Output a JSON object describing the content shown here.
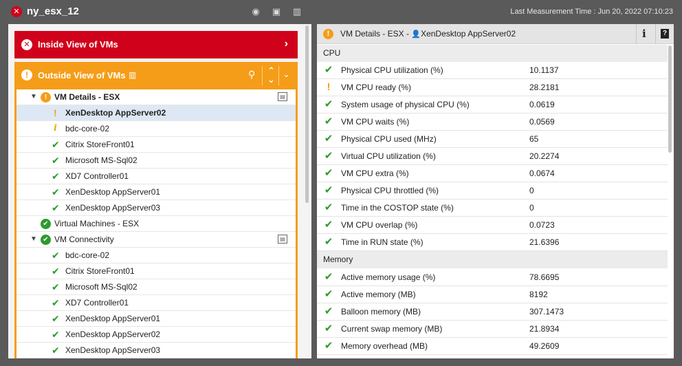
{
  "titlebar": {
    "title": "ny_esx_12",
    "status_icon": "error-x-icon",
    "measurement": "Last Measurement Time : Jun 20, 2022 07:10:23",
    "icons": [
      "alarm-icon",
      "monitor-icon",
      "bar-chart-icon"
    ]
  },
  "inside": {
    "label": "Inside View of VMs"
  },
  "outside": {
    "label": "Outside View of VMs"
  },
  "tree": {
    "vm_details": {
      "label": "VM Details - ESX"
    },
    "details_items": [
      {
        "label": "XenDesktop AppServer02",
        "status": "warning"
      },
      {
        "label": "bdc-core-02",
        "status": "info"
      },
      {
        "label": "Citrix StoreFront01",
        "status": "ok"
      },
      {
        "label": "Microsoft MS-Sql02",
        "status": "ok"
      },
      {
        "label": "XD7 Controller01",
        "status": "ok"
      },
      {
        "label": "XenDesktop AppServer01",
        "status": "ok"
      },
      {
        "label": "XenDesktop AppServer03",
        "status": "ok"
      }
    ],
    "virtual_machines": {
      "label": "Virtual Machines - ESX"
    },
    "vm_connectivity": {
      "label": "VM Connectivity"
    },
    "connectivity_items": [
      {
        "label": "bdc-core-02"
      },
      {
        "label": "Citrix StoreFront01"
      },
      {
        "label": "Microsoft MS-Sql02"
      },
      {
        "label": "XD7 Controller01"
      },
      {
        "label": "XenDesktop AppServer01"
      },
      {
        "label": "XenDesktop AppServer02"
      },
      {
        "label": "XenDesktop AppServer03"
      }
    ]
  },
  "details": {
    "title_prefix": "VM Details - ESX - ",
    "title_vm": "XenDesktop AppServer02",
    "cpu_section": "CPU",
    "cpu": [
      {
        "name": "Physical CPU utilization (%)",
        "value": "10.1137",
        "status": "ok"
      },
      {
        "name": "VM CPU ready (%)",
        "value": "28.2181",
        "status": "warning"
      },
      {
        "name": "System usage of physical CPU (%)",
        "value": "0.0619",
        "status": "ok"
      },
      {
        "name": "VM CPU waits (%)",
        "value": "0.0569",
        "status": "ok"
      },
      {
        "name": "Physical CPU used (MHz)",
        "value": "65",
        "status": "ok"
      },
      {
        "name": "Virtual CPU utilization (%)",
        "value": "20.2274",
        "status": "ok"
      },
      {
        "name": "VM CPU extra (%)",
        "value": "0.0674",
        "status": "ok"
      },
      {
        "name": "Physical CPU throttled (%)",
        "value": "0",
        "status": "ok"
      },
      {
        "name": "Time in the COSTOP state (%)",
        "value": "0",
        "status": "ok"
      },
      {
        "name": "VM CPU overlap (%)",
        "value": "0.0723",
        "status": "ok"
      },
      {
        "name": "Time in RUN state (%)",
        "value": "21.6396",
        "status": "ok"
      }
    ],
    "memory_section": "Memory",
    "memory": [
      {
        "name": "Active memory usage (%)",
        "value": "78.6695",
        "status": "ok"
      },
      {
        "name": "Active memory (MB)",
        "value": "8192",
        "status": "ok"
      },
      {
        "name": "Balloon memory (MB)",
        "value": "307.1473",
        "status": "ok"
      },
      {
        "name": "Current swap memory (MB)",
        "value": "21.8934",
        "status": "ok"
      },
      {
        "name": "Memory overhead (MB)",
        "value": "49.2609",
        "status": "ok"
      }
    ]
  },
  "colors": {
    "critical": "#d0021b",
    "warning": "#f59d18",
    "ok": "#2e9a2e"
  }
}
